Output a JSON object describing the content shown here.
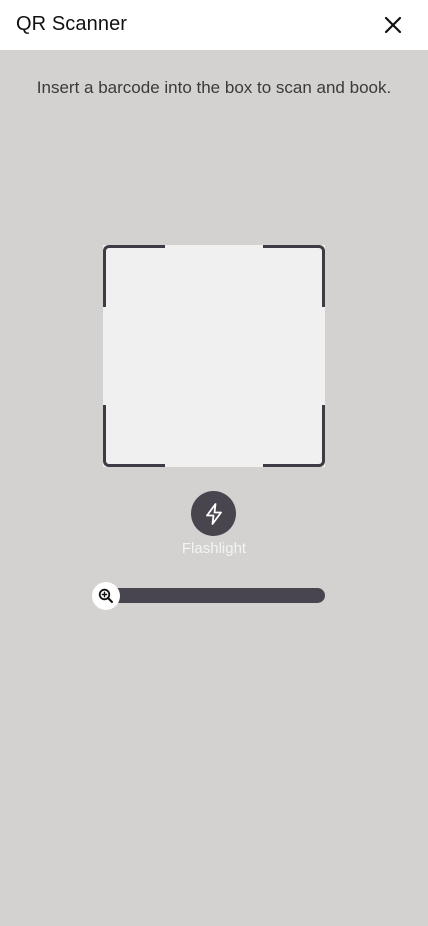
{
  "header": {
    "title": "QR Scanner",
    "close_icon": "close-icon"
  },
  "instruction": "Insert a barcode into the box to scan and book.",
  "scanner": {
    "flashlight_label": "Flashlight",
    "flashlight_icon": "lightning-bolt-icon"
  },
  "zoom": {
    "icon": "zoom-in-icon",
    "level": 0
  },
  "colors": {
    "background": "#d3d2d1",
    "accent": "#48454e",
    "frame": "#3e3b44",
    "scan_area": "#f0f0f0"
  }
}
